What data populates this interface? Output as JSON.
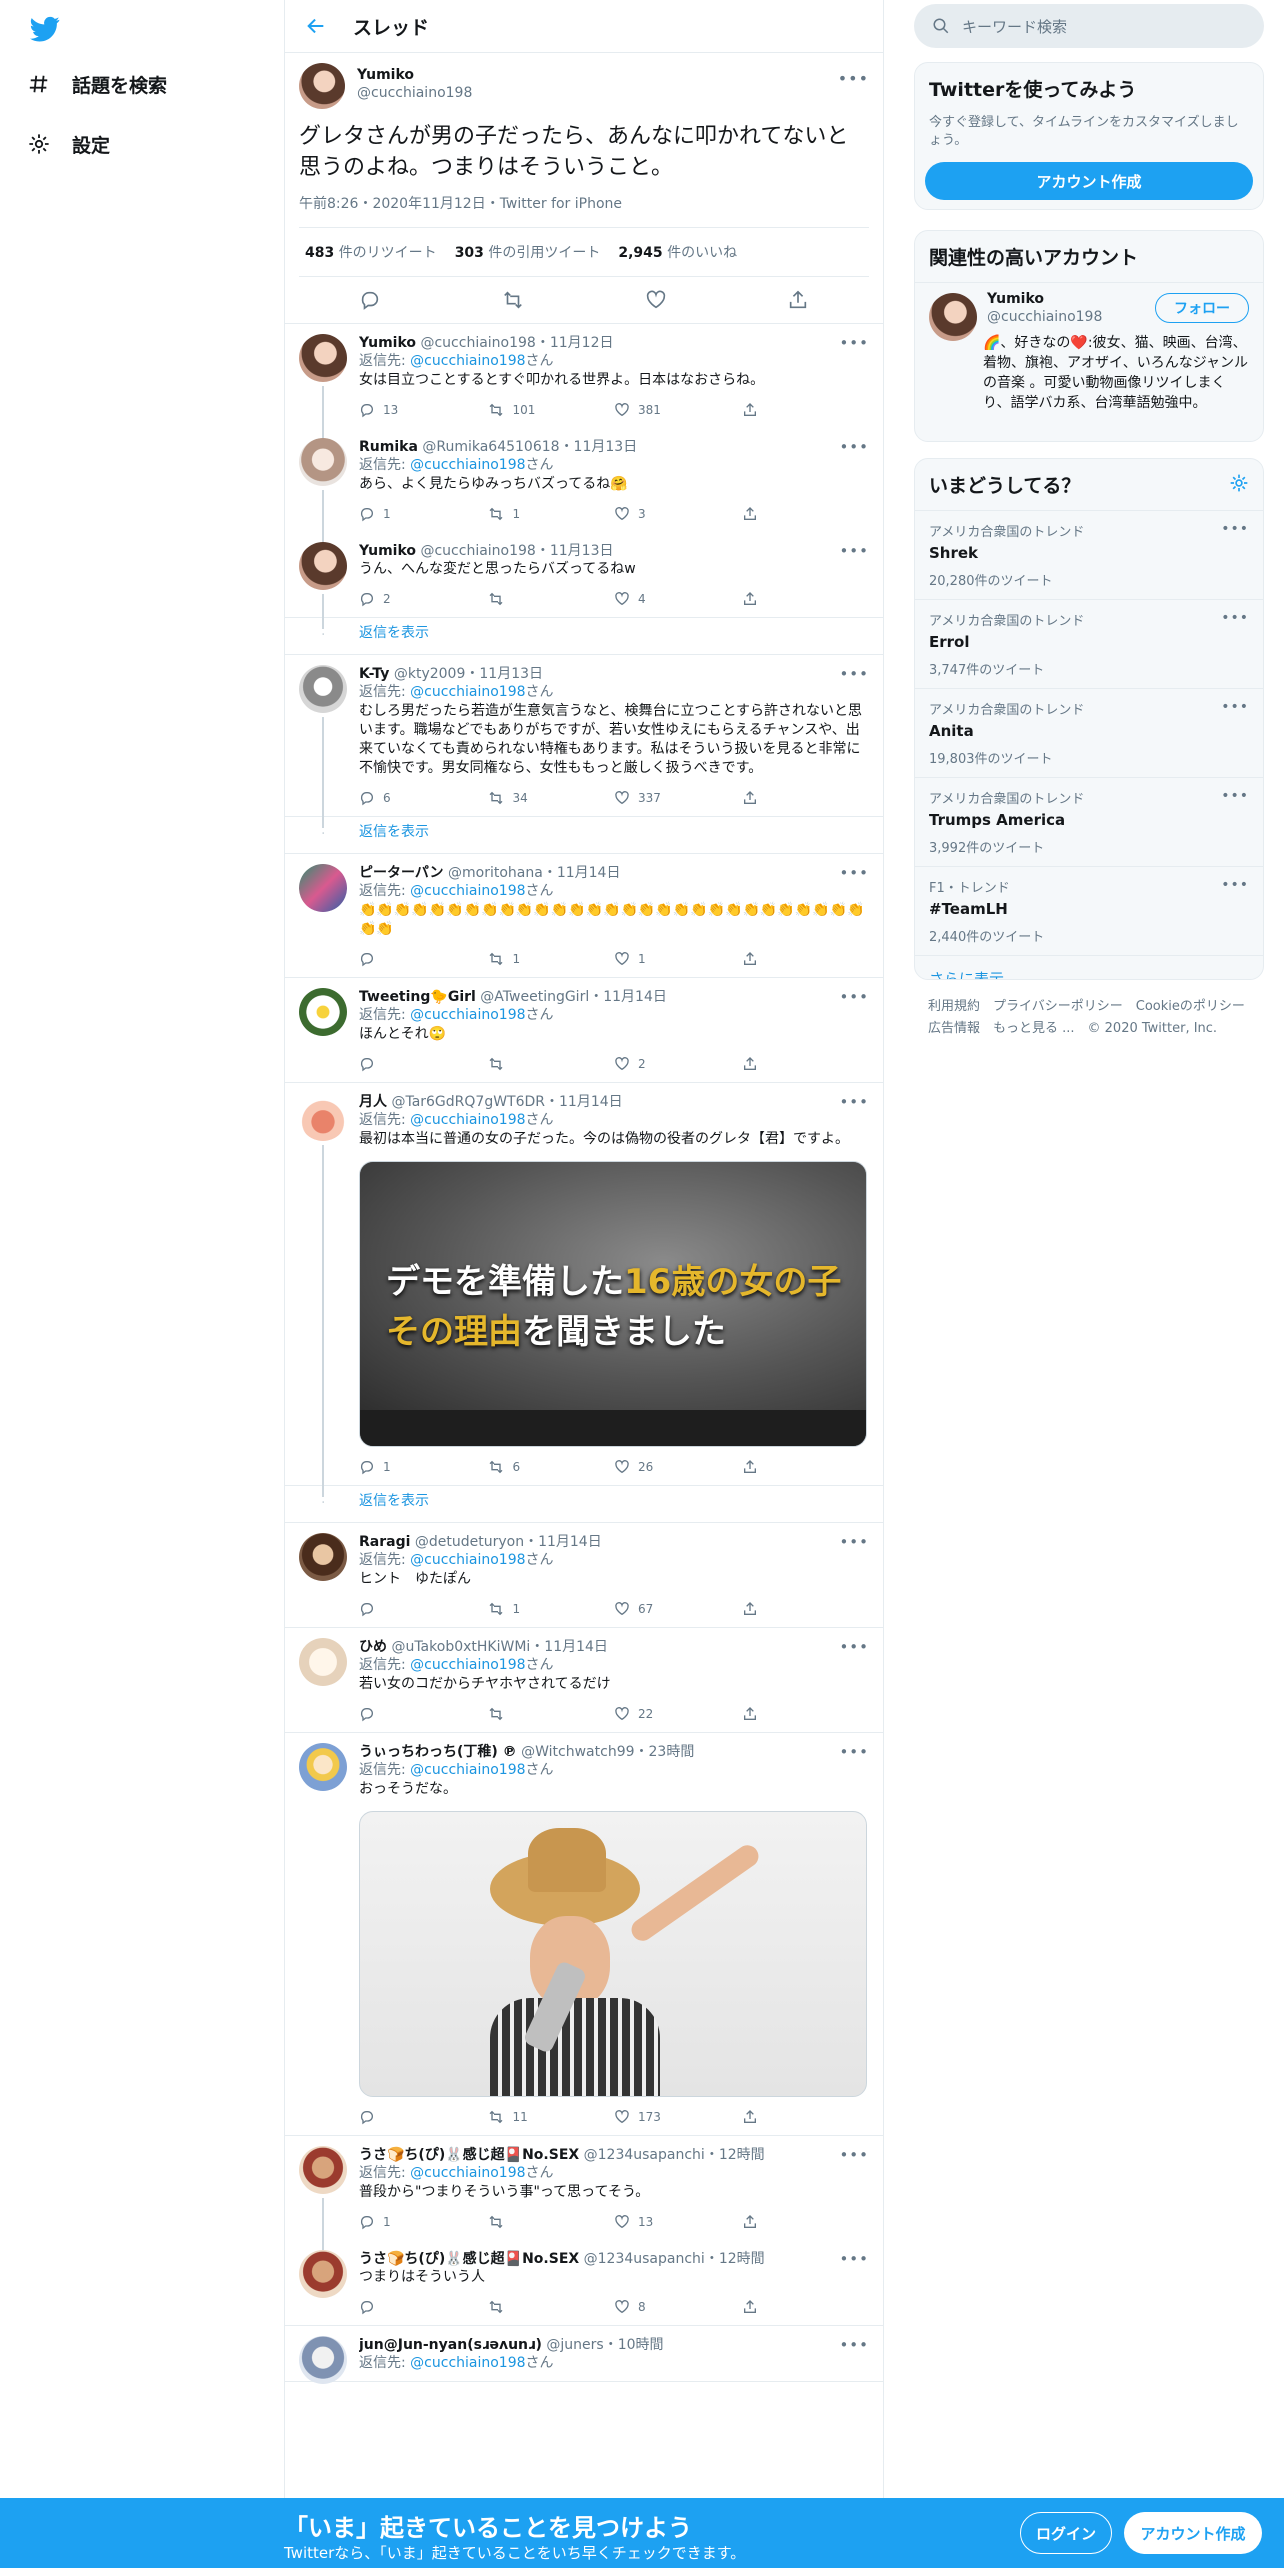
{
  "nav": {
    "explore_label": "話題を検索",
    "settings_label": "設定"
  },
  "header": {
    "title": "スレッド"
  },
  "focal": {
    "name": "Yumiko",
    "handle": "@cucchiaino198",
    "text": "グレタさんが男の子だったら、あんなに叩かれてないと思うのよね。つまりはそういうこと。",
    "meta": "午前8:26・2020年11月12日・Twitter for iPhone",
    "retweets": "483",
    "retweets_label": "件のリツイート",
    "quotes": "303",
    "quotes_label": "件の引用ツイート",
    "likes": "2,945",
    "likes_label": "件のいいね"
  },
  "reply_prefix": "返信先:",
  "reply_suffix": "さん",
  "show_replies": "返信を表示",
  "tweets": [
    {
      "name": "Yumiko",
      "handle": "@cucchiaino198",
      "date": "・11月12日",
      "reply_to": "@cucchiaino198",
      "text": "女は目立つことするとすぐ叩かれる世界よ。日本はなおさらね。",
      "replies": "13",
      "retweets": "101",
      "likes": "381"
    },
    {
      "name": "Rumika",
      "handle": "@Rumika64510618",
      "date": "・11月13日",
      "reply_to": "@cucchiaino198",
      "text": "あら、よく見たらゆみっちバズってるね🤗",
      "replies": "1",
      "retweets": "1",
      "likes": "3"
    },
    {
      "name": "Yumiko",
      "handle": "@cucchiaino198",
      "date": "・11月13日",
      "reply_to": "",
      "text": "うん、へんな変だと思ったらバズってるねw",
      "replies": "2",
      "retweets": "",
      "likes": "4"
    },
    {
      "name": "K-Ty",
      "handle": "@kty2009",
      "date": "・11月13日",
      "reply_to": "@cucchiaino198",
      "text": "むしろ男だったら若造が生意気言うなと、検舞台に立つことすら許されないと思います。職場などでもありがちですが、若い女性ゆえにもらえるチャンスや、出来ていなくても責められない特権もあります。私はそういう扱いを見ると非常に不愉快です。男女同権なら、女性ももっと厳しく扱うべきです。",
      "replies": "6",
      "retweets": "34",
      "likes": "337"
    },
    {
      "name": "ピーターパン",
      "handle": "@moritohana",
      "date": "・11月14日",
      "reply_to": "@cucchiaino198",
      "text": "👏👏👏👏👏👏👏👏👏👏👏👏👏👏👏👏👏👏👏👏👏👏👏👏👏👏👏👏👏👏👏",
      "replies": "",
      "retweets": "1",
      "likes": "1"
    },
    {
      "name": "Tweeting🐤Girl",
      "handle": "@ATweetingGirl",
      "date": "・11月14日",
      "reply_to": "@cucchiaino198",
      "text": "ほんとそれ🙄",
      "replies": "",
      "retweets": "",
      "likes": "2"
    },
    {
      "name": "月人",
      "handle": "@Tar6GdRQ7gWT6DR",
      "date": "・11月14日",
      "reply_to": "@cucchiaino198",
      "text": "最初は本当に普通の女の子だった。今のは偽物の役者のグレタ【君】ですよ。",
      "replies": "1",
      "retweets": "6",
      "likes": "26"
    },
    {
      "name": "Raragi",
      "handle": "@detudeturyon",
      "date": "・11月14日",
      "reply_to": "@cucchiaino198",
      "text": "ヒント　ゆたぽん",
      "replies": "",
      "retweets": "1",
      "likes": "67"
    },
    {
      "name": "ひめ",
      "handle": "@uTakob0xtHKiWMi",
      "date": "・11月14日",
      "reply_to": "@cucchiaino198",
      "text": "若い女のコだからチヤホヤされてるだけ",
      "replies": "",
      "retweets": "",
      "likes": "22"
    },
    {
      "name": "うぃっちわっち(丁稚) ℗",
      "handle": "@Witchwatch99",
      "date": "・23時間",
      "reply_to": "@cucchiaino198",
      "text": "おっそうだな。",
      "replies": "",
      "retweets": "11",
      "likes": "173"
    },
    {
      "name": "うさ🍞ち(ぴ)🐰感じ超🎴No.SEX",
      "handle": "@1234usapanchi",
      "date": "・12時間",
      "reply_to": "@cucchiaino198",
      "text": "普段から\"つまりそういう事\"って思ってそう。",
      "replies": "1",
      "retweets": "",
      "likes": "13"
    },
    {
      "name": "うさ🍞ち(ぴ)🐰感じ超🎴No.SEX",
      "handle": "@1234usapanchi",
      "date": "・12時間",
      "reply_to": "",
      "text": "つまりはそういう人",
      "replies": "",
      "retweets": "",
      "likes": "8"
    },
    {
      "name": "jun@Jun-nyan(sɹəʌunɹ)",
      "handle": "@juners",
      "date": "・10時間",
      "reply_to": "@cucchiaino198",
      "text": "",
      "replies": "",
      "retweets": "",
      "likes": ""
    }
  ],
  "media": {
    "video_line1a": "デモを準備した",
    "video_line1b": "16歳の女の子",
    "video_line2a": "その理由",
    "video_line2b": "を聞きました"
  },
  "right": {
    "search_placeholder": "キーワード検索",
    "signup_title": "Twitterを使ってみよう",
    "signup_sub": "今すぐ登録して、タイムラインをカスタマイズしましょう。",
    "signup_button": "アカウント作成",
    "related_title": "関連性の高いアカウント",
    "related_name": "Yumiko",
    "related_handle": "@cucchiaino198",
    "follow_label": "フォロー",
    "related_bio": "🌈、好きなの❤️:彼女、猫、映画、台湾、着物、旗袍、アオザイ、いろんなジャンルの音楽 。可愛い動物画像リツイしまくり、語学バカ系、台湾華語勉強中。",
    "trends_title": "いまどうしてる？",
    "trends": [
      {
        "cat": "アメリカ合衆国のトレンド",
        "name": "Shrek",
        "count": "20,280件のツイート"
      },
      {
        "cat": "アメリカ合衆国のトレンド",
        "name": "Errol",
        "count": "3,747件のツイート"
      },
      {
        "cat": "アメリカ合衆国のトレンド",
        "name": "Anita",
        "count": "19,803件のツイート"
      },
      {
        "cat": "アメリカ合衆国のトレンド",
        "name": "Trumps America",
        "count": "3,992件のツイート"
      },
      {
        "cat": "F1・トレンド",
        "name": "#TeamLH",
        "count": "2,440件のツイート"
      }
    ],
    "show_more": "さらに表示",
    "footer1": "利用規約　プライバシーポリシー　Cookieのポリシー",
    "footer2": "広告情報　もっと見る ...　© 2020 Twitter, Inc."
  },
  "banner": {
    "title": "「いま」起きていることを見つけよう",
    "sub": "Twitterなら、「いま」起きていることをいち早くチェックできます。",
    "login": "ログイン",
    "signup": "アカウント作成"
  },
  "colors": {
    "accent": "#1da1f2",
    "link": "#1b95e0",
    "muted": "#657786",
    "border": "#e6ecf0"
  }
}
